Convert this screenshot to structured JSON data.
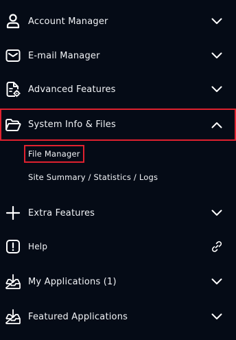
{
  "colors": {
    "background": "#050b16",
    "text": "#f2f4f7",
    "highlight_border": "#e0212f"
  },
  "menu": {
    "items": [
      {
        "label": "Account Manager",
        "icon": "user-icon",
        "chevron": "chevron-down-icon"
      },
      {
        "label": "E-mail Manager",
        "icon": "envelope-icon",
        "chevron": "chevron-down-icon"
      },
      {
        "label": "Advanced Features",
        "icon": "document-gear-icon",
        "chevron": "chevron-down-icon"
      },
      {
        "label": "System Info & Files",
        "icon": "folder-icon",
        "chevron": "chevron-up-icon",
        "expanded": true
      },
      {
        "label": "Extra Features",
        "icon": "plus-icon",
        "chevron": "chevron-down-icon"
      },
      {
        "label": "Help",
        "icon": "exclamation-icon",
        "chevron": "link-icon"
      },
      {
        "label": "My Applications (1)",
        "icon": "download-tray-icon",
        "chevron": "chevron-down-icon"
      },
      {
        "label": "Featured Applications",
        "icon": "download-tray-icon",
        "chevron": "chevron-down-icon"
      }
    ],
    "submenu": [
      {
        "label": "File Manager"
      },
      {
        "label": "Site Summary / Statistics / Logs"
      }
    ]
  }
}
